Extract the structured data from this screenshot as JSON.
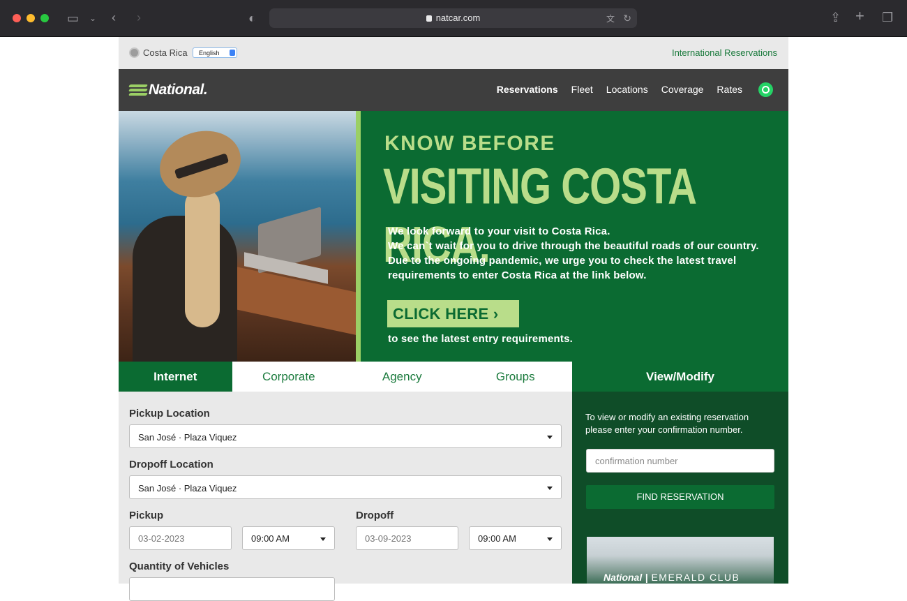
{
  "browser": {
    "url": "natcar.com"
  },
  "topbar": {
    "country": "Costa Rica",
    "language": "English",
    "international_link": "International Reservations"
  },
  "nav": {
    "logo": "National.",
    "items": [
      "Reservations",
      "Fleet",
      "Locations",
      "Coverage",
      "Rates"
    ]
  },
  "hero": {
    "kicker": "KNOW BEFORE",
    "headline": "VISITING COSTA RICA.",
    "body_line1": "We look forward to your visit to Costa Rica.",
    "body_line2": "We can`t wait for you to drive through the beautiful roads of our country. Due to the ongoing pandemic, we urge you to check the latest travel requirements to enter Costa Rica at the link below.",
    "cta": "CLICK HERE  ›",
    "cta_note": "to see the latest entry requirements."
  },
  "tabs": [
    "Internet",
    "Corporate",
    "Agency",
    "Groups"
  ],
  "form": {
    "pickup_location_label": "Pickup Location",
    "pickup_location_value": "San José · Plaza Viquez",
    "dropoff_location_label": "Dropoff Location",
    "dropoff_location_value": "San José · Plaza Viquez",
    "pickup_label": "Pickup",
    "pickup_date": "03-02-2023",
    "pickup_time": "09:00 AM",
    "dropoff_label": "Dropoff",
    "dropoff_date": "03-09-2023",
    "dropoff_time": "09:00 AM",
    "quantity_label": "Quantity of Vehicles"
  },
  "view_modify": {
    "tab": "View/Modify",
    "text": "To view or modify an existing reservation please enter your confirmation number.",
    "placeholder": "confirmation number",
    "button": "FIND RESERVATION",
    "banner_brand": "National",
    "banner_club": "EMERALD CLUB"
  },
  "colors": {
    "brand_green": "#0b6b32",
    "accent_lime": "#b9dd8a",
    "dark_nav": "#3e3e3e"
  }
}
